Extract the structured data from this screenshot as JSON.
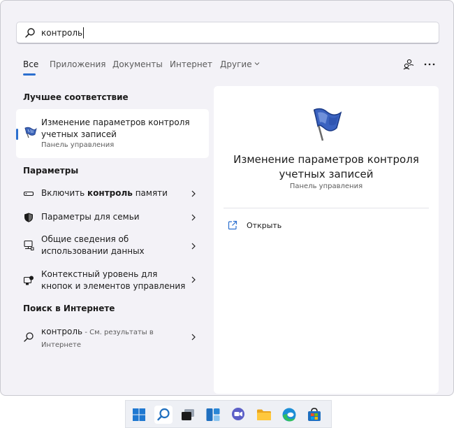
{
  "search": {
    "query": "контроль"
  },
  "tabs": [
    {
      "label": "Все"
    },
    {
      "label": "Приложения"
    },
    {
      "label": "Документы"
    },
    {
      "label": "Интернет"
    },
    {
      "label": "Другие"
    }
  ],
  "best_match": {
    "section": "Лучшее соответствие",
    "title": "Изменение параметров контроля учетных записей",
    "subtitle": "Панель управления"
  },
  "settings": {
    "section": "Параметры",
    "items": [
      {
        "pre": "Включить ",
        "bold": "контроль",
        "post": " памяти"
      },
      {
        "label": "Параметры для семьи"
      },
      {
        "label": "Общие сведения об использовании данных"
      },
      {
        "label": "Контекстный уровень для кнопок и элементов управления"
      }
    ]
  },
  "web": {
    "section": "Поиск в Интернете",
    "query": "контроль",
    "hint": " - См. результаты в Интернете"
  },
  "detail": {
    "title": "Изменение параметров контроля учетных записей",
    "subtitle": "Панель управления",
    "open_label": "Открыть"
  },
  "taskbar": [
    "start-icon",
    "search-icon",
    "task-view-icon",
    "widgets-icon",
    "chat-icon",
    "file-explorer-icon",
    "edge-icon",
    "store-icon"
  ],
  "colors": {
    "accent": "#2b6fcf",
    "panel": "#f3f2f7",
    "card": "#ffffff"
  }
}
